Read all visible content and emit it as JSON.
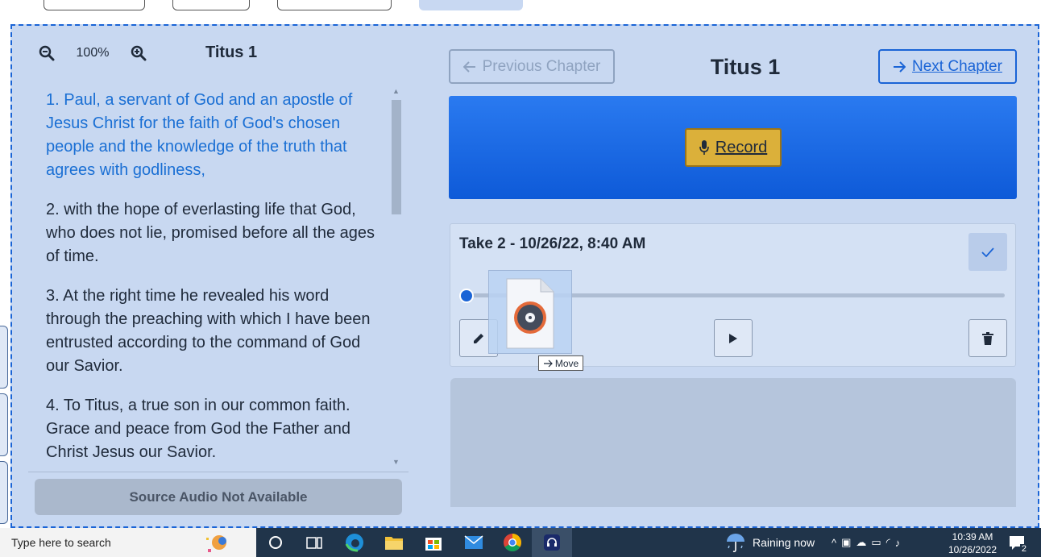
{
  "top_tabs": [
    {
      "label": ""
    },
    {
      "label": ""
    },
    {
      "label": ""
    },
    {
      "label": "",
      "active": true
    }
  ],
  "left_pane": {
    "zoom_level": "100%",
    "title": "Titus 1",
    "verses": [
      "1. Paul, a servant of God and an apostle of Jesus Christ for the faith of God's chosen people and the knowledge of the truth that agrees with godliness,",
      "2. with the hope of everlasting life that God, who does not lie, promised before all the ages of time.",
      "3. At the right time he revealed his word through the preaching with which I have been entrusted according to the command of God our Savior.",
      "4. To Titus, a true son in our common faith. Grace and peace from God the Father and Christ Jesus our Savior."
    ],
    "source_audio_label": "Source Audio Not Available"
  },
  "right_pane": {
    "prev_label": "Previous Chapter",
    "chapter_title": "Titus 1",
    "next_label": "Next Chapter",
    "record_label": "Record",
    "take": {
      "title": "Take 2 - 10/26/22, 8:40 AM",
      "progress": 0.0
    }
  },
  "drag": {
    "tooltip": "Move"
  },
  "taskbar": {
    "search_placeholder": "Type here to search",
    "weather": "Raining now",
    "time": "10:39 AM",
    "date": "10/26/2022",
    "notification_count": "2"
  },
  "colors": {
    "accent": "#1a64d6",
    "panel_bg": "#c8d8f1",
    "record_button": "#dbb03a",
    "current_verse": "#1a6fd4"
  }
}
